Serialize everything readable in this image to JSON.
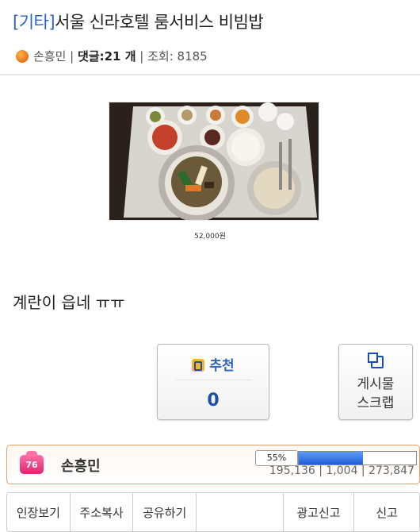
{
  "post": {
    "category": "[기타]",
    "title": "서울 신라호텔 룸서비스 비빔밥",
    "author": "손흥민",
    "comments_label": "댓글:",
    "comments_count": "21 개",
    "views_label": "조회:",
    "views_count": "8185",
    "photo_caption": "52,000원",
    "body": "계란이 읍네 ㅠㅠ"
  },
  "buttons": {
    "recommend_label": "추천",
    "recommend_count": "0",
    "scrap_line1": "게시물",
    "scrap_line2": "스크랩"
  },
  "user_bar": {
    "level": "76",
    "name": "손흥민",
    "progress_percent": "55%",
    "progress_value": 55,
    "stats": "195,136 | 1,004 | 273,847"
  },
  "actions": [
    "인장보기",
    "주소복사",
    "공유하기",
    "",
    "광고신고",
    "신고"
  ],
  "colors": {
    "accent": "#2a64c0",
    "level_badge": "#e0246d",
    "bar_fill": "#1e5fd3"
  }
}
